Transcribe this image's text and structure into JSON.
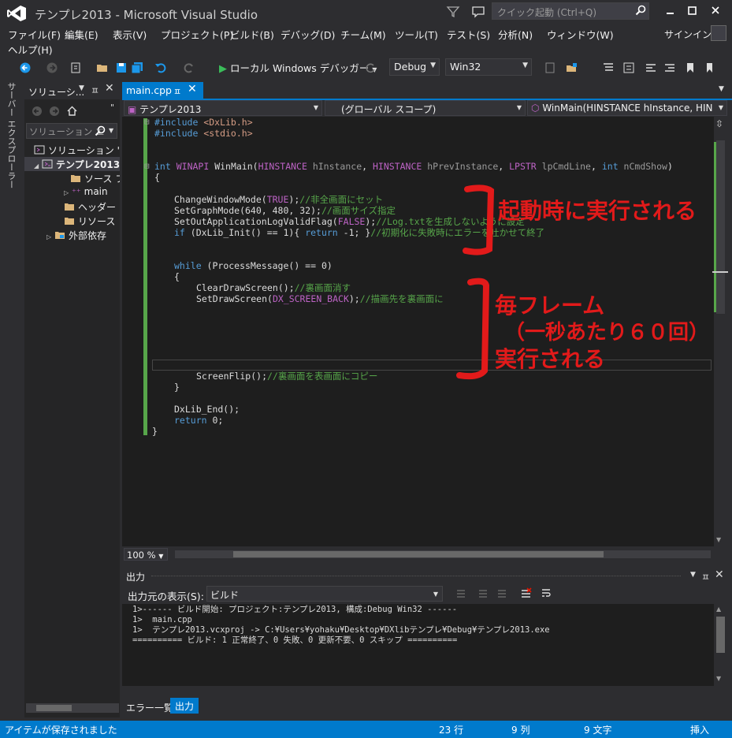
{
  "window": {
    "title": "テンプレ2013 - Microsoft Visual Studio",
    "quick_launch_placeholder": "クイック起動 (Ctrl+Q)",
    "signin": "サインイン"
  },
  "menu": [
    "ファイル(F)",
    "編集(E)",
    "表示(V)",
    "プロジェクト(P)",
    "ビルド(B)",
    "デバッグ(D)",
    "チーム(M)",
    "ツール(T)",
    "テスト(S)",
    "分析(N)",
    "ウィンドウ(W)",
    "ヘルプ(H)"
  ],
  "toolbar": {
    "run_label": "ローカル Windows デバッガー",
    "config": "Debug",
    "platform": "Win32"
  },
  "left_strip": "サーバー エクスプローラー",
  "solution_explorer": {
    "title": "ソリューシ...",
    "search_placeholder": "ソリューション エ",
    "items": [
      {
        "label": "ソリューション 'テンプ"
      },
      {
        "label": "テンプレ2013"
      },
      {
        "label": "ソース ファ"
      },
      {
        "label": "main"
      },
      {
        "label": "ヘッダー フ"
      },
      {
        "label": "リソース フ"
      },
      {
        "label": "外部依存"
      }
    ]
  },
  "editor": {
    "tab_label": "main.cpp",
    "nav_project": "テンプレ2013",
    "nav_scope": "(グローバル スコープ)",
    "nav_member": "WinMain(HINSTANCE hInstance, HIN",
    "zoom": "100 %",
    "code": [
      {
        "kw": "#include",
        "rest": " <DxLib.h>"
      },
      {
        "kw": "#include",
        "rest": " <stdio.h>"
      },
      {
        "sig_int": "int",
        "sig_winapi": "WINAPI",
        "sig_fn": " WinMain(",
        "t1": "HINSTANCE",
        "p1": " hInstance",
        "c1": ", ",
        "t2": "HINSTANCE",
        "p2": " hPrevInstance",
        "c2": ", ",
        "t3": "LPSTR",
        "p3": " lpCmdLine",
        "c3": ", ",
        "t4": "int",
        "p4": " nCmdShow",
        "close": ")"
      },
      {
        "text": "{"
      },
      {
        "pre": "ChangeWindowMode(",
        "mac": "TRUE",
        "post": ");",
        "cmt": "//非全画面にセット"
      },
      {
        "pre": "SetGraphMode(640, 480, 32);",
        "cmt": "//画面サイズ指定"
      },
      {
        "pre": "SetOutApplicationLogValidFlag(",
        "mac": "FALSE",
        "post": ");",
        "cmt": "//Log.txtを生成しないように設定"
      },
      {
        "kw": "if",
        "pre": " (DxLib_Init() == 1){ ",
        "kw2": "return",
        "post": " -1; }",
        "cmt": "//初期化に失敗時にエラーを吐かせて終了"
      },
      {
        "kw": "while",
        "post": " (ProcessMessage() == 0)"
      },
      {
        "text": "{"
      },
      {
        "pre": "ClearDrawScreen();",
        "cmt": "//裏画面消す"
      },
      {
        "pre": "SetDrawScreen(",
        "mac": "DX_SCREEN_BACK",
        "post": ");",
        "cmt": "//描画先を裏画面に"
      },
      {
        "pre": "ScreenFlip();",
        "cmt": "//裏画面を表画面にコピー"
      },
      {
        "text": "}"
      },
      {
        "pre": "DxLib_End();"
      },
      {
        "kw": "return",
        "post": " 0;"
      },
      {
        "text": "}"
      }
    ]
  },
  "annotations": {
    "first": "起動時に実行される",
    "second_line1": "毎フレーム",
    "second_line2": "（一秒あたり６０回）",
    "second_line3": "実行される"
  },
  "output": {
    "title": "出力",
    "source_label": "出力元の表示(S):",
    "source_value": "ビルド",
    "lines": [
      "1>------ ビルド開始: プロジェクト:テンプレ2013, 構成:Debug Win32 ------",
      "1>  main.cpp",
      "1>  テンプレ2013.vcxproj -> C:¥Users¥yohaku¥Desktop¥DXlibテンプレ¥Debug¥テンプレ2013.exe",
      "========== ビルド: 1 正常終了、0 失敗、0 更新不要、0 スキップ =========="
    ]
  },
  "bottom_tabs": {
    "errors": "エラー一覧",
    "output": "出力"
  },
  "status": {
    "message": "アイテムが保存されました",
    "line": "23 行",
    "col": "9 列",
    "chars": "9 文字",
    "mode": "挿入"
  },
  "colors": {
    "accent": "#007acc",
    "annotation": "#e21a1a",
    "change_bar": "#57a64a"
  }
}
